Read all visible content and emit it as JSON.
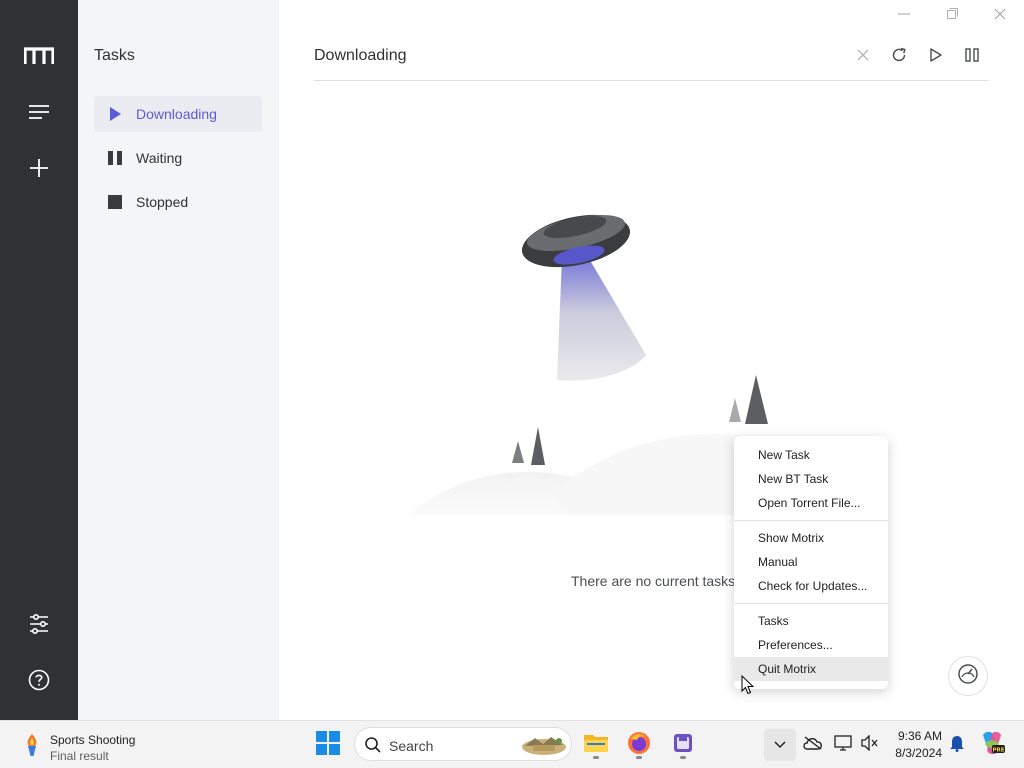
{
  "sidebar": {
    "title": "Tasks",
    "items": [
      {
        "label": "Downloading"
      },
      {
        "label": "Waiting"
      },
      {
        "label": "Stopped"
      }
    ]
  },
  "header": {
    "title": "Downloading"
  },
  "empty": {
    "text": "There are no current tasks"
  },
  "context_menu": {
    "items": [
      {
        "label": "New Task"
      },
      {
        "label": "New BT Task"
      },
      {
        "label": "Open Torrent File..."
      },
      {
        "label": "Show Motrix"
      },
      {
        "label": "Manual"
      },
      {
        "label": "Check for Updates..."
      },
      {
        "label": "Tasks"
      },
      {
        "label": "Preferences..."
      },
      {
        "label": "Quit Motrix"
      }
    ]
  },
  "taskbar": {
    "weather_title": "Sports Shooting",
    "weather_sub": "Final result",
    "search_placeholder": "Search",
    "time": "9:36 AM",
    "date": "8/3/2024"
  },
  "colors": {
    "accent": "#5b5bd6",
    "rail": "#303133",
    "sidebar": "#f4f5f7"
  },
  "icons": [
    "motrix-logo-icon",
    "menu-icon",
    "add-icon",
    "preferences-icon",
    "help-icon",
    "play-icon",
    "pause-icon",
    "stop-icon",
    "close-icon",
    "refresh-icon",
    "resume-all-icon",
    "pause-all-icon",
    "speedometer-icon",
    "windows-start-icon",
    "search-icon",
    "file-explorer-icon",
    "firefox-icon",
    "app-icon",
    "chevron-up-icon",
    "onedrive-icon",
    "network-icon",
    "volume-icon",
    "notification-bell-icon",
    "copilot-icon"
  ]
}
